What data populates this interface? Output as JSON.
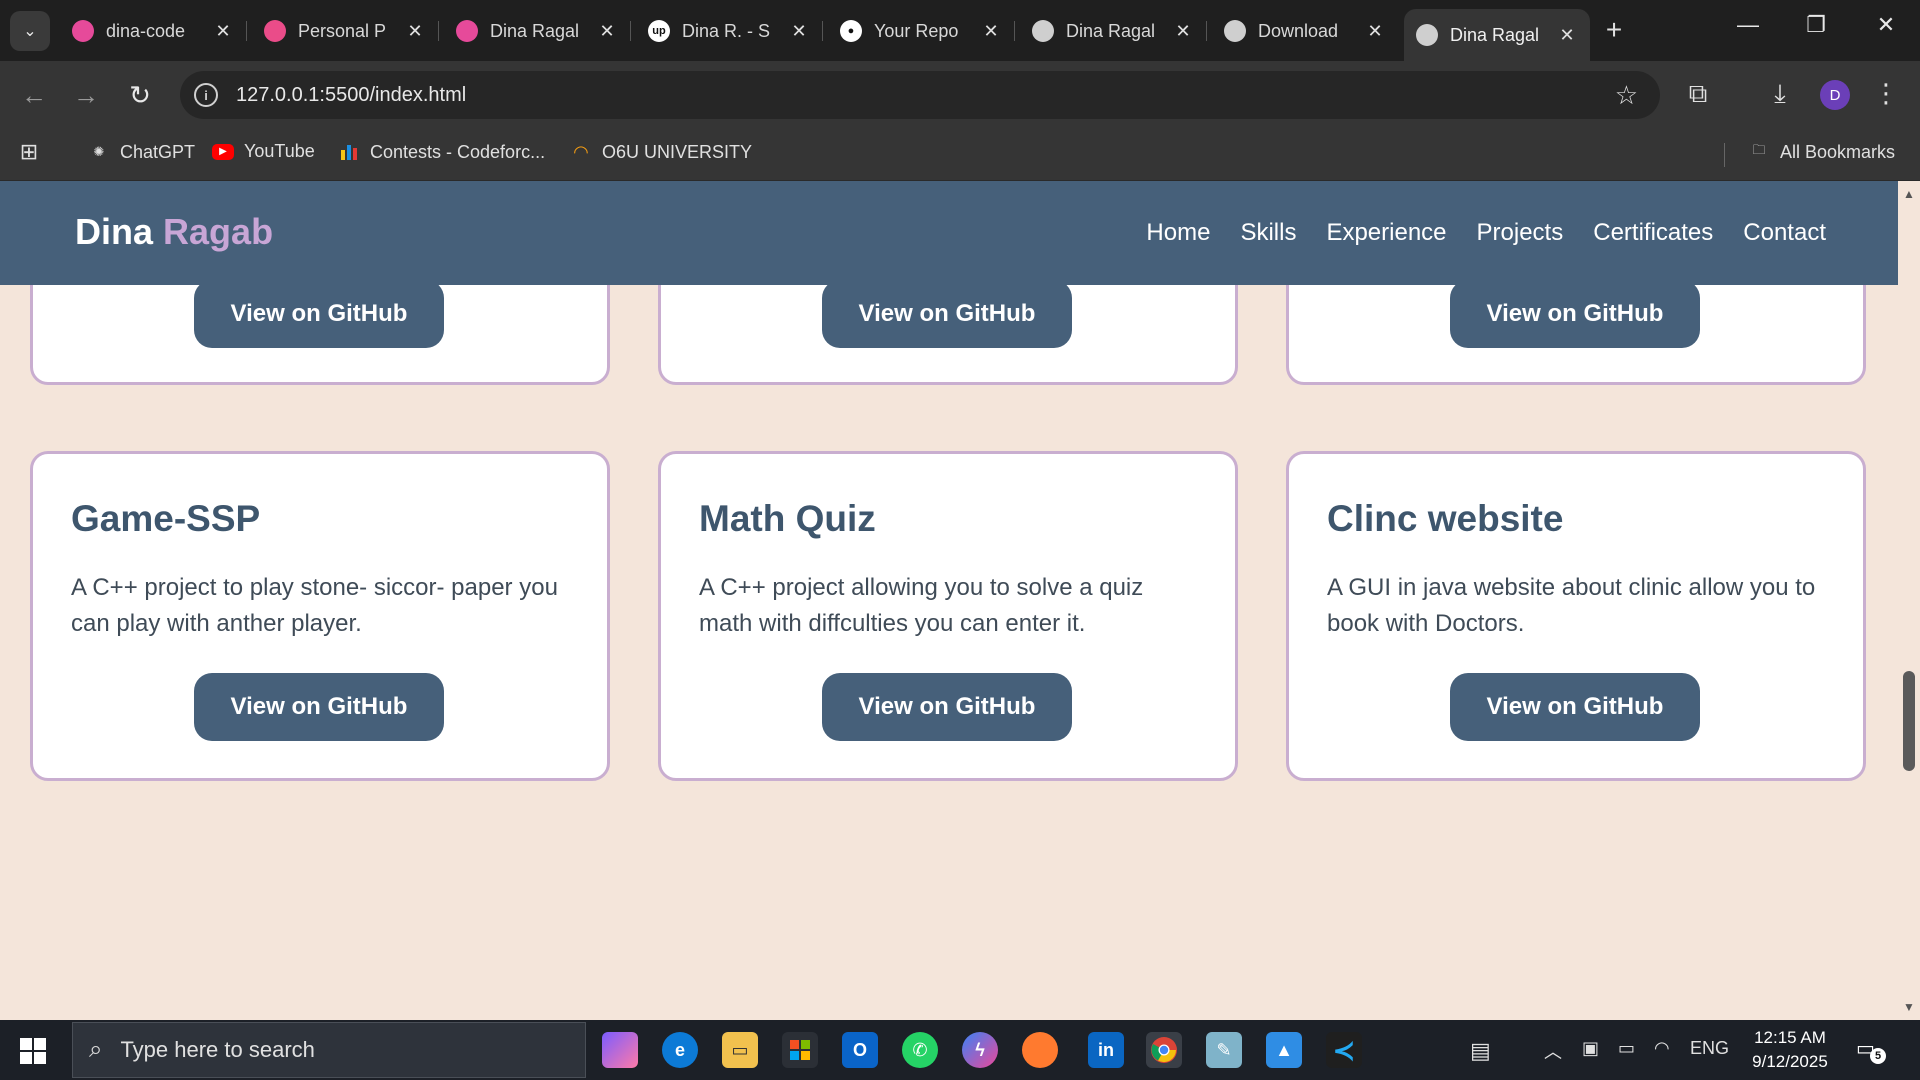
{
  "browser": {
    "tabs": [
      {
        "title": "dina-code",
        "icon": "figma-icon",
        "color": "#e64a9a"
      },
      {
        "title": "Personal P",
        "icon": "dribbble-icon",
        "color": "#ea4c89"
      },
      {
        "title": "Dina Ragal",
        "icon": "figma-icon",
        "color": "#e64a9a"
      },
      {
        "title": "Dina R. - S",
        "icon": "upwork-icon",
        "color": "#ffffff"
      },
      {
        "title": "Your Repo",
        "icon": "github-icon",
        "color": "#ffffff"
      },
      {
        "title": "Dina Ragal",
        "icon": "globe-icon",
        "color": "#cfcfcf"
      },
      {
        "title": "Download",
        "icon": "chatgpt-icon",
        "color": "#cfcfcf"
      },
      {
        "title": "Dina Ragal",
        "icon": "globe-icon",
        "color": "#cfcfcf"
      }
    ],
    "url": "127.0.0.1:5500/index.html",
    "avatar_letter": "D",
    "bookmarks": [
      {
        "label": "ChatGPT",
        "icon": "chatgpt-icon"
      },
      {
        "label": "YouTube",
        "icon": "youtube-icon"
      },
      {
        "label": "Contests - Codeforc...",
        "icon": "codeforces-icon"
      },
      {
        "label": "O6U UNIVERSITY",
        "icon": "university-icon"
      }
    ],
    "all_bookmarks": "All Bookmarks"
  },
  "site": {
    "logo_first": "Dina",
    "logo_second": "Ragab",
    "nav": [
      "Home",
      "Skills",
      "Experience",
      "Projects",
      "Certificates",
      "Contact"
    ],
    "button_label": "View on GitHub",
    "projects": [
      {
        "title": "Game-SSP",
        "desc": "A C++ project to play stone- siccor- paper you can play with anther player."
      },
      {
        "title": "Math Quiz",
        "desc": "A C++ project allowing you to solve a quiz math with diffculties you can enter it."
      },
      {
        "title": "Clinc website",
        "desc": "A GUI in java website about clinic allow you to book with Doctors."
      }
    ]
  },
  "taskbar": {
    "search_placeholder": "Type here to search",
    "language": "ENG",
    "time": "12:15 AM",
    "date": "9/12/2025",
    "notification_count": "5"
  }
}
